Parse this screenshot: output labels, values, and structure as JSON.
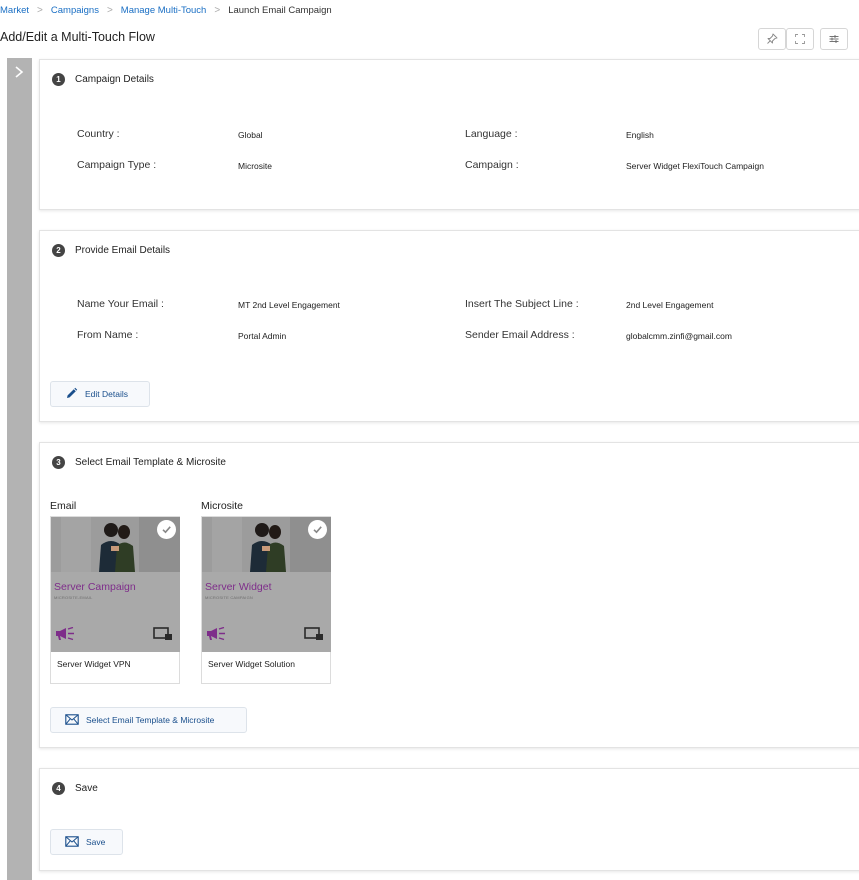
{
  "breadcrumb": {
    "items": [
      "Market",
      "Campaigns",
      "Manage Multi-Touch",
      "Launch Email Campaign"
    ]
  },
  "page": {
    "title": "Add/Edit a Multi-Touch Flow"
  },
  "toolbar": {
    "icons": [
      "pin-icon",
      "expand-icon",
      "settings-sliders-icon"
    ]
  },
  "sidebar": {
    "toggle_icon": "chevron-right-icon"
  },
  "steps": {
    "campaign_details": {
      "number": "1",
      "title": "Campaign Details",
      "fields": {
        "country_label": "Country :",
        "country_value": "Global",
        "language_label": "Language :",
        "language_value": "English",
        "type_label": "Campaign Type :",
        "type_value": "Microsite",
        "campaign_label": "Campaign :",
        "campaign_value": "Server Widget FlexiTouch Campaign"
      }
    },
    "email_details": {
      "number": "2",
      "title": "Provide Email Details",
      "fields": {
        "name_label": "Name Your Email :",
        "name_value": "MT 2nd Level Engagement",
        "subject_label": "Insert The Subject Line :",
        "subject_value": "2nd Level Engagement",
        "from_label": "From Name :",
        "from_value": "Portal Admin",
        "sender_label": "Sender Email Address :",
        "sender_value": "globalcmm.zinfi@gmail.com"
      },
      "edit_button": "Edit Details"
    },
    "templates": {
      "number": "3",
      "title": "Select Email Template & Microsite",
      "email": {
        "heading": "Email",
        "thumb_title": "Server Campaign",
        "thumb_subtitle": "MICROSITE-EMAIL",
        "caption": "Server Widget VPN"
      },
      "microsite": {
        "heading": "Microsite",
        "thumb_title": "Server Widget",
        "thumb_subtitle": "MICROSITE CAMPAIGN",
        "caption": "Server Widget Solution"
      },
      "select_button": "Select Email Template & Microsite"
    },
    "save": {
      "number": "4",
      "title": "Save",
      "button": "Save"
    }
  },
  "colors": {
    "link": "#1a6fc4",
    "button_text": "#1a4f8c",
    "brand_purple": "#7e2d8a",
    "thumbnail_gray": "#a9a9a9"
  }
}
